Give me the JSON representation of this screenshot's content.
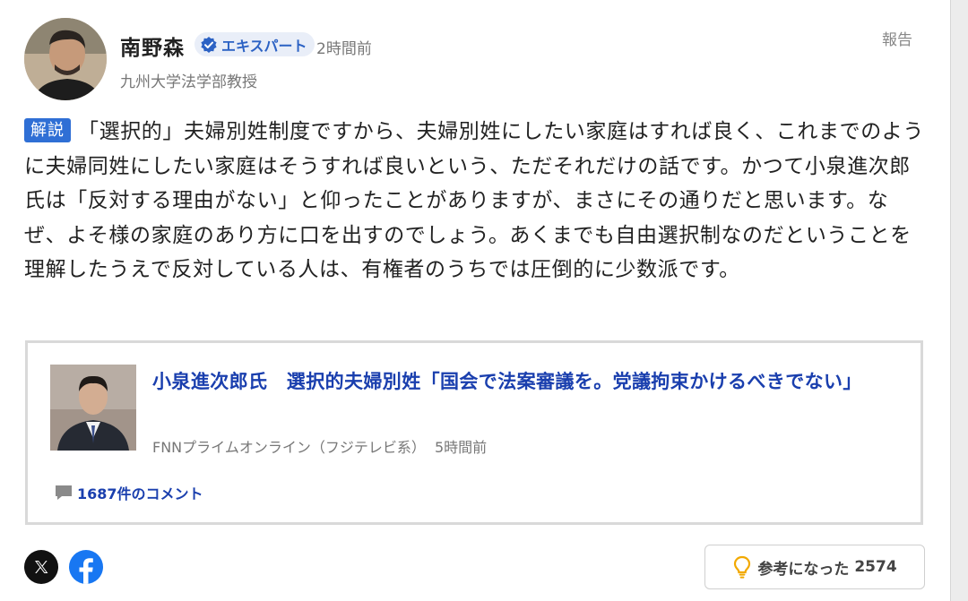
{
  "author": {
    "name": "南野森",
    "badge": "エキスパート",
    "time": "2時間前",
    "title": "九州大学法学部教授"
  },
  "report_label": "報告",
  "comment": {
    "tag": "解説",
    "text": "「選択的」夫婦別姓制度ですから、夫婦別姓にしたい家庭はすれば良く、これまでのように夫婦同姓にしたい家庭はそうすれば良いという、ただそれだけの話です。かつて小泉進次郎氏は「反対する理由がない」と仰ったことがありますが、まさにその通りだと思います。なぜ、よそ様の家庭のあり方に口を出すのでしょう。あくまでも自由選択制なのだということを理解したうえで反対している人は、有権者のうちでは圧倒的に少数派です。"
  },
  "article": {
    "title": "小泉進次郎氏　選択的夫婦別姓「国会で法案審議を。党議拘束かけるべきでない」",
    "source": "FNNプライムオンライン（フジテレビ系）",
    "time": "5時間前",
    "comments_label": "1687件のコメント"
  },
  "footer": {
    "share_icons": [
      "x-icon",
      "facebook-icon"
    ],
    "helpful_label": "参考になった",
    "helpful_count": "2574"
  },
  "colors": {
    "accent": "#2f6fd5",
    "link": "#1a3fae",
    "badge_bg": "#e9eef8",
    "facebook": "#1877f2",
    "bulb": "#f2a900"
  }
}
